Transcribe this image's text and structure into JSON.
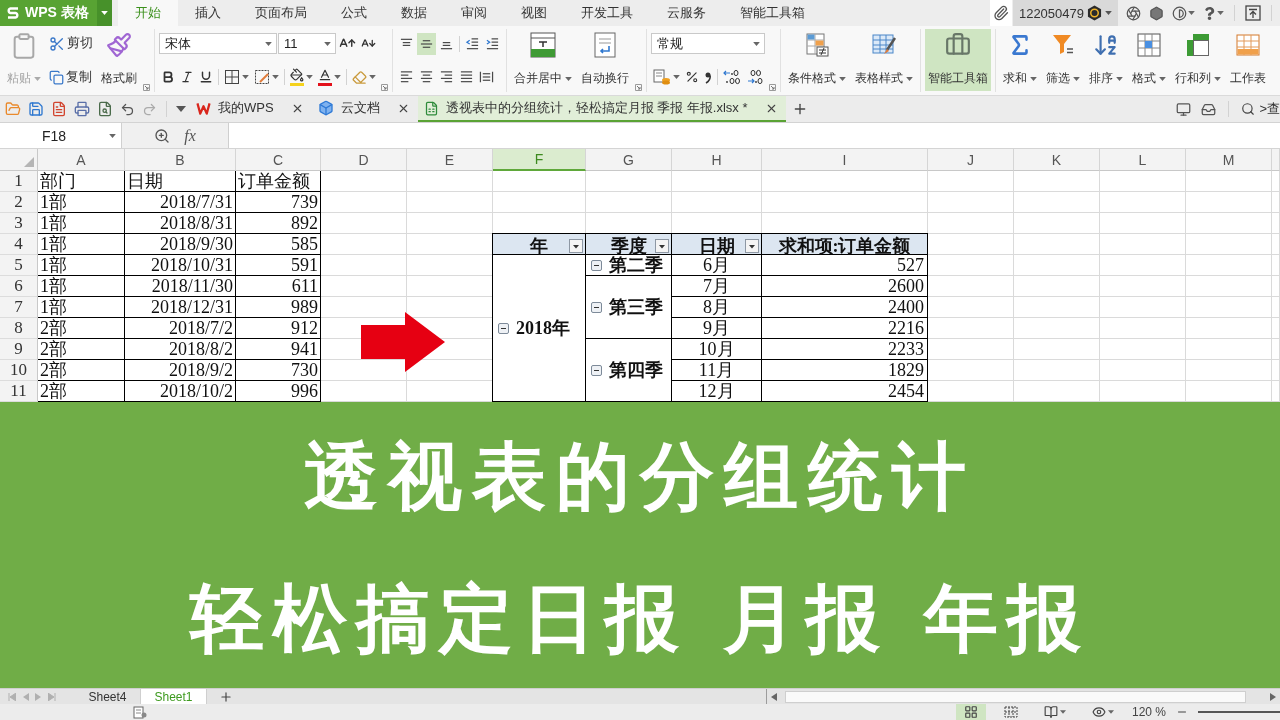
{
  "title_bar": {
    "app_menu": "WPS 表格",
    "tabs": [
      {
        "label": "开始",
        "selected": true
      },
      {
        "label": "插入",
        "selected": false
      },
      {
        "label": "页面布局",
        "selected": false
      },
      {
        "label": "公式",
        "selected": false
      },
      {
        "label": "数据",
        "selected": false
      },
      {
        "label": "审阅",
        "selected": false
      },
      {
        "label": "视图",
        "selected": false
      },
      {
        "label": "开发工具",
        "selected": false
      },
      {
        "label": "云服务",
        "selected": false
      },
      {
        "label": "智能工具箱",
        "selected": false
      }
    ],
    "account_id": "122050479"
  },
  "ribbon": {
    "paste": {
      "label": "粘贴",
      "disabled": true
    },
    "cut": "剪切",
    "copy": "复制",
    "format_painter": "格式刷",
    "font_name": "宋体",
    "font_size": "11",
    "vertical_align": [
      {
        "selected": false
      },
      {
        "selected": true
      },
      {
        "selected": false
      }
    ],
    "merge_center": "合并居中",
    "wrap_text": "自动换行",
    "number_format": "常规",
    "tools": [
      {
        "label": "条件格式",
        "menu": true,
        "selected": false
      },
      {
        "label": "表格样式",
        "menu": true,
        "selected": false
      },
      {
        "label": "智能工具箱",
        "menu": false,
        "selected": true
      },
      {
        "label": "求和",
        "menu": true,
        "selected": false
      },
      {
        "label": "筛选",
        "menu": true,
        "selected": false
      },
      {
        "label": "排序",
        "menu": true,
        "selected": false
      },
      {
        "label": "格式",
        "menu": true,
        "selected": false
      },
      {
        "label": "行和列",
        "menu": true,
        "selected": false
      },
      {
        "label": "工作表",
        "menu": false,
        "selected": false
      }
    ]
  },
  "document_tabs": [
    {
      "label": "我的WPS",
      "selected": false
    },
    {
      "label": "云文档",
      "selected": false
    },
    {
      "label": "透视表中的分组统计，轻松搞定月报 季报 年报.xlsx *",
      "selected": true
    }
  ],
  "search": {
    "label": ">查"
  },
  "formula_bar": {
    "name_box": "F18",
    "function_button": "fx"
  },
  "sheet": {
    "columns": [
      {
        "label": "A",
        "selected": false
      },
      {
        "label": "B",
        "selected": false
      },
      {
        "label": "C",
        "selected": false
      },
      {
        "label": "D",
        "selected": false
      },
      {
        "label": "E",
        "selected": false
      },
      {
        "label": "F",
        "selected": true
      },
      {
        "label": "G",
        "selected": false
      },
      {
        "label": "H",
        "selected": false
      },
      {
        "label": "I",
        "selected": false
      },
      {
        "label": "J",
        "selected": false
      },
      {
        "label": "K",
        "selected": false
      },
      {
        "label": "L",
        "selected": false
      },
      {
        "label": "M",
        "selected": false
      }
    ],
    "row_numbers": [
      "1",
      "2",
      "3",
      "4",
      "5",
      "6",
      "7",
      "8",
      "9",
      "10",
      "11"
    ]
  },
  "data_table": {
    "header": [
      "部门",
      "日期",
      "订单金额"
    ],
    "rows": [
      [
        "1部",
        "2018/7/31",
        "739"
      ],
      [
        "1部",
        "2018/8/31",
        "892"
      ],
      [
        "1部",
        "2018/9/30",
        "585"
      ],
      [
        "1部",
        "2018/10/31",
        "591"
      ],
      [
        "1部",
        "2018/11/30",
        "611"
      ],
      [
        "1部",
        "2018/12/31",
        "989"
      ],
      [
        "2部",
        "2018/7/2",
        "912"
      ],
      [
        "2部",
        "2018/8/2",
        "941"
      ],
      [
        "2部",
        "2018/9/2",
        "730"
      ],
      [
        "2部",
        "2018/10/2",
        "996"
      ]
    ]
  },
  "pivot": {
    "headers": [
      {
        "label": "年",
        "filter": true
      },
      {
        "label": "季度",
        "filter": true
      },
      {
        "label": "日期",
        "filter": true
      },
      {
        "label": "求和项:订单金额",
        "filter": false
      }
    ],
    "years": [
      {
        "label": "2018年",
        "expanded": true,
        "quarters": [
          {
            "label": "第二季",
            "expanded": true,
            "months": [
              {
                "month": "6月",
                "sum": "527"
              }
            ]
          },
          {
            "label": "第三季",
            "expanded": true,
            "months": [
              {
                "month": "7月",
                "sum": "2600"
              },
              {
                "month": "8月",
                "sum": "2400"
              },
              {
                "month": "9月",
                "sum": "2216"
              }
            ]
          },
          {
            "label": "第四季",
            "expanded": true,
            "months": [
              {
                "month": "10月",
                "sum": "2233"
              },
              {
                "month": "11月",
                "sum": "1829"
              },
              {
                "month": "12月",
                "sum": "2454"
              }
            ]
          }
        ]
      }
    ]
  },
  "banner": {
    "title": "透视表的分组统计",
    "subtitle": "轻松搞定日报 月报 年报"
  },
  "sheet_tabs": [
    {
      "label": "Sheet4",
      "selected": false
    },
    {
      "label": "Sheet1",
      "selected": true
    }
  ],
  "status_bar": {
    "views": [
      {
        "selected": true
      },
      {
        "selected": false
      },
      {
        "selected": false
      },
      {
        "selected": false
      }
    ],
    "zoom": "120 %"
  }
}
